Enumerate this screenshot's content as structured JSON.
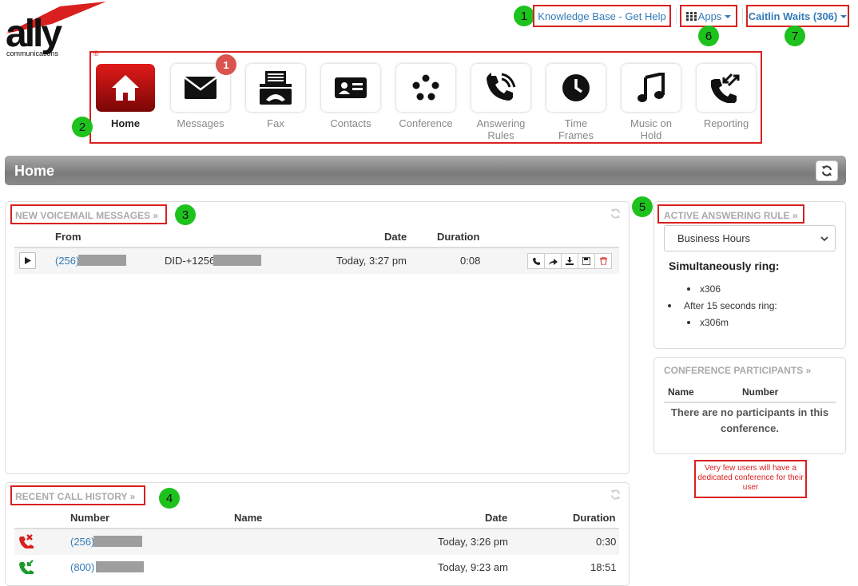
{
  "brand": {
    "logo_text": "ally",
    "logo_sub": "communications",
    "registered": "®"
  },
  "header": {
    "knowledge_base": "Knowledge Base - Get Help",
    "apps": "Apps",
    "user": "Caitlin Waits (306)"
  },
  "callouts": [
    "1",
    "2",
    "3",
    "4",
    "5",
    "6",
    "7"
  ],
  "tiles": [
    {
      "label": "Home",
      "icon": "home-icon"
    },
    {
      "label": "Messages",
      "icon": "envelope-icon",
      "badge": "1"
    },
    {
      "label": "Fax",
      "icon": "fax-icon"
    },
    {
      "label": "Contacts",
      "icon": "contact-card-icon"
    },
    {
      "label": "Conference",
      "icon": "conference-dots-icon"
    },
    {
      "label": "Answering Rules",
      "icon": "phone-ringing-icon"
    },
    {
      "label": "Time Frames",
      "icon": "clock-icon"
    },
    {
      "label": "Music on Hold",
      "icon": "music-note-icon"
    },
    {
      "label": "Reporting",
      "icon": "phone-arrows-icon"
    }
  ],
  "home_bar": {
    "title": "Home"
  },
  "voicemail": {
    "title": "NEW VOICEMAIL MESSAGES »",
    "columns": {
      "from": "From",
      "date": "Date",
      "duration": "Duration"
    },
    "rows": [
      {
        "from": "(256)",
        "to": "DID-+1256",
        "date": "Today, 3:27 pm",
        "duration": "0:08"
      }
    ]
  },
  "call_history": {
    "title": "RECENT CALL HISTORY »",
    "columns": {
      "number": "Number",
      "name": "Name",
      "date": "Date",
      "duration": "Duration"
    },
    "rows": [
      {
        "type": "missed-call-icon",
        "number": "(256)",
        "date": "Today, 3:26 pm",
        "duration": "0:30"
      },
      {
        "type": "incoming-call-icon",
        "number": "(800)",
        "date": "Today, 9:23 am",
        "duration": "18:51"
      }
    ]
  },
  "answering_rule": {
    "title": "ACTIVE ANSWERING RULE »",
    "selected": "Business Hours",
    "simultaneous_label": "Simultaneously ring:",
    "sim_items": [
      "x306"
    ],
    "after_label": "After 15 seconds ring:",
    "after_items": [
      "x306m"
    ]
  },
  "conference": {
    "title": "CONFERENCE PARTICIPANTS »",
    "columns": {
      "name": "Name",
      "number": "Number"
    },
    "empty": "There are no participants in this conference."
  },
  "note": "Very few users will have a dedicated conference for their user",
  "colors": {
    "accent": "#337ab7",
    "callout_green": "#1dc21d",
    "annotation_red": "#d9201f",
    "missed": "#d9201f",
    "incoming": "#1a9a2a"
  }
}
